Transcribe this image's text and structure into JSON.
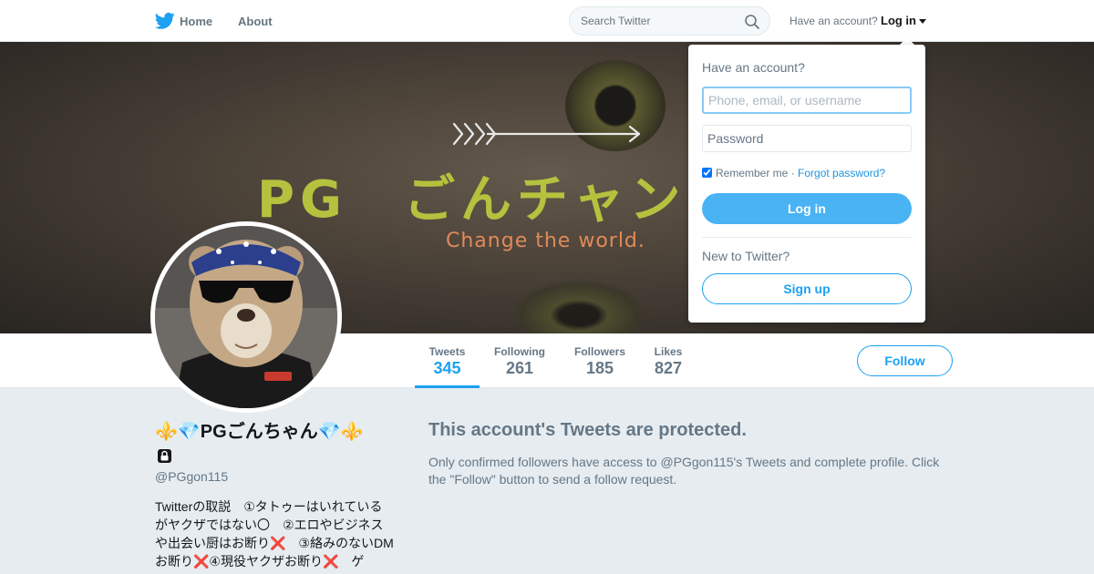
{
  "nav": {
    "home_label": "Home",
    "about_label": "About",
    "search_placeholder": "Search Twitter",
    "have_account_text": "Have an account?",
    "login_label": "Log in",
    "icons": {
      "logo": "twitter-bird-icon",
      "search": "search-icon",
      "caret": "caret-down-icon"
    }
  },
  "banner": {
    "title": "PG　ごんチャン",
    "subtitle": "Change the world."
  },
  "profile_nav": {
    "stats": [
      {
        "label": "Tweets",
        "value": "345",
        "active": true
      },
      {
        "label": "Following",
        "value": "261",
        "active": false
      },
      {
        "label": "Followers",
        "value": "185",
        "active": false
      },
      {
        "label": "Likes",
        "value": "827",
        "active": false
      }
    ],
    "follow_label": "Follow"
  },
  "profile": {
    "display_name": "⚜️💎PGごんちゃん💎⚜️",
    "handle": "@PGgon115",
    "bio": "Twitterの取説　①タトゥーはいれているがヤクザではない〇　②エロやビジネスや出会い厨はお断り❌　③絡みのないDMお断り❌④現役ヤクザお断り❌　ゲ"
  },
  "protected": {
    "title": "This account's Tweets are protected.",
    "text": "Only confirmed followers have access to @PGgon115's Tweets and complete profile. Click the \"Follow\" button to send a follow request."
  },
  "login_dropdown": {
    "heading": "Have an account?",
    "username_placeholder": "Phone, email, or username",
    "password_placeholder": "Password",
    "remember_label": "Remember me",
    "separator": " · ",
    "forgot_label": "Forgot password?",
    "login_button": "Log in",
    "new_to_twitter": "New to Twitter?",
    "signup_button": "Sign up"
  },
  "colors": {
    "brand": "#1da1f2",
    "login_button": "#4ab3f4",
    "banner_title": "#b5c23e",
    "banner_subtitle": "#e08a5a",
    "page_background": "#e6ecf0"
  }
}
